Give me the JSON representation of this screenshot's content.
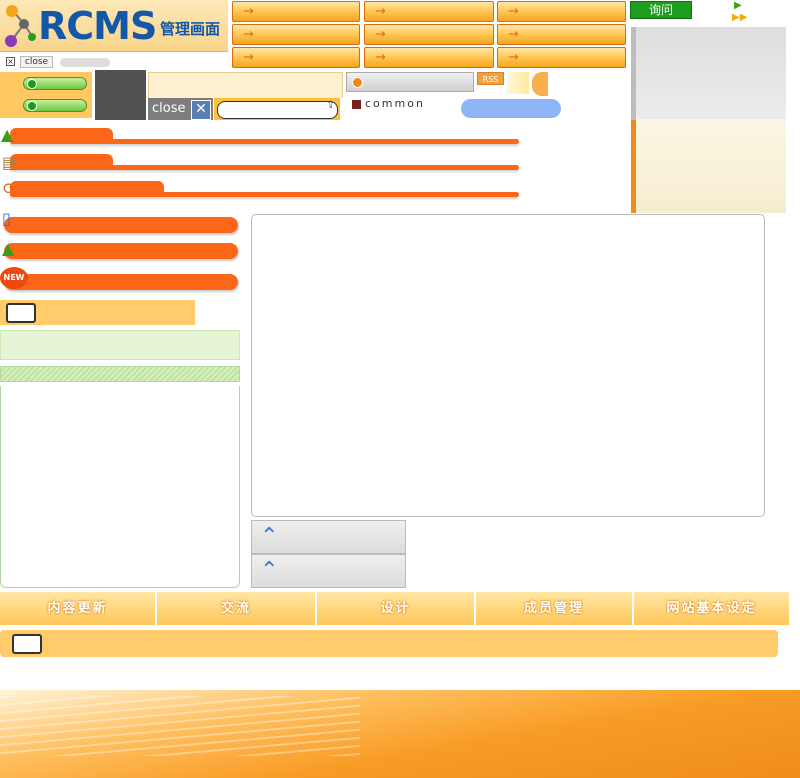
{
  "header": {
    "logo_main": "RCMS",
    "logo_sub": "管理画面",
    "inquiry_label": "询问",
    "small_close_label": "close",
    "big_close_label": "close",
    "rss_label": "RSS",
    "common_label": "common"
  },
  "top_nav": {
    "rows": [
      [
        "",
        "",
        ""
      ],
      [
        "",
        "",
        ""
      ],
      [
        "",
        "",
        ""
      ]
    ]
  },
  "search": {
    "placeholder": ""
  },
  "bottom_tabs": [
    {
      "label": "内容更新"
    },
    {
      "label": "交流"
    },
    {
      "label": "设计"
    },
    {
      "label": "成员管理"
    },
    {
      "label": "网站基本设定"
    }
  ],
  "icons": {
    "logo": "molecule-icon",
    "menu1": "green-cone-icon",
    "menu2": "book-stack-icon",
    "menu3": "refresh-icon",
    "side1": "mobile-phone-icon",
    "side2": "green-cone-icon",
    "side3": "new-badge-icon",
    "side4": "open-book-icon",
    "up": "up-arrow-icon"
  },
  "colors": {
    "orange": "#fb6716",
    "peach": "#ffcb6b",
    "blue": "#1457a8",
    "green": "#1f9d1f"
  }
}
